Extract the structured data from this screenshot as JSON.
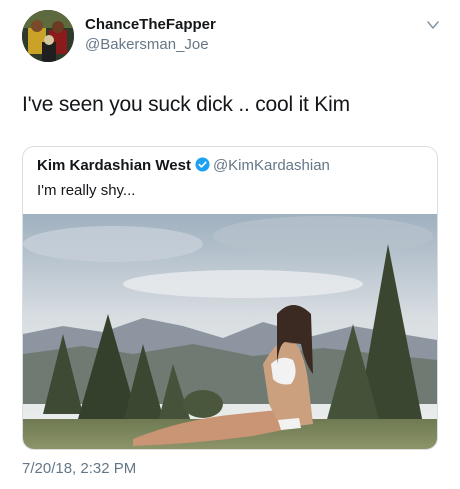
{
  "tweet": {
    "display_name": "ChanceTheFapper",
    "handle": "@Bakersman_Joe",
    "text": "I've seen you suck dick .. cool it Kim",
    "timestamp": "7/20/18, 2:32 PM"
  },
  "quoted_tweet": {
    "display_name": "Kim Kardashian West",
    "handle": "@KimKardashian",
    "text": "I'm really shy...",
    "verified": true
  },
  "icons": {
    "menu": "chevron-down-icon",
    "verified": "verified-badge-icon"
  },
  "colors": {
    "text_primary": "#14171a",
    "text_secondary": "#657786",
    "verified_blue": "#1da1f2",
    "border": "#d8dee3"
  }
}
